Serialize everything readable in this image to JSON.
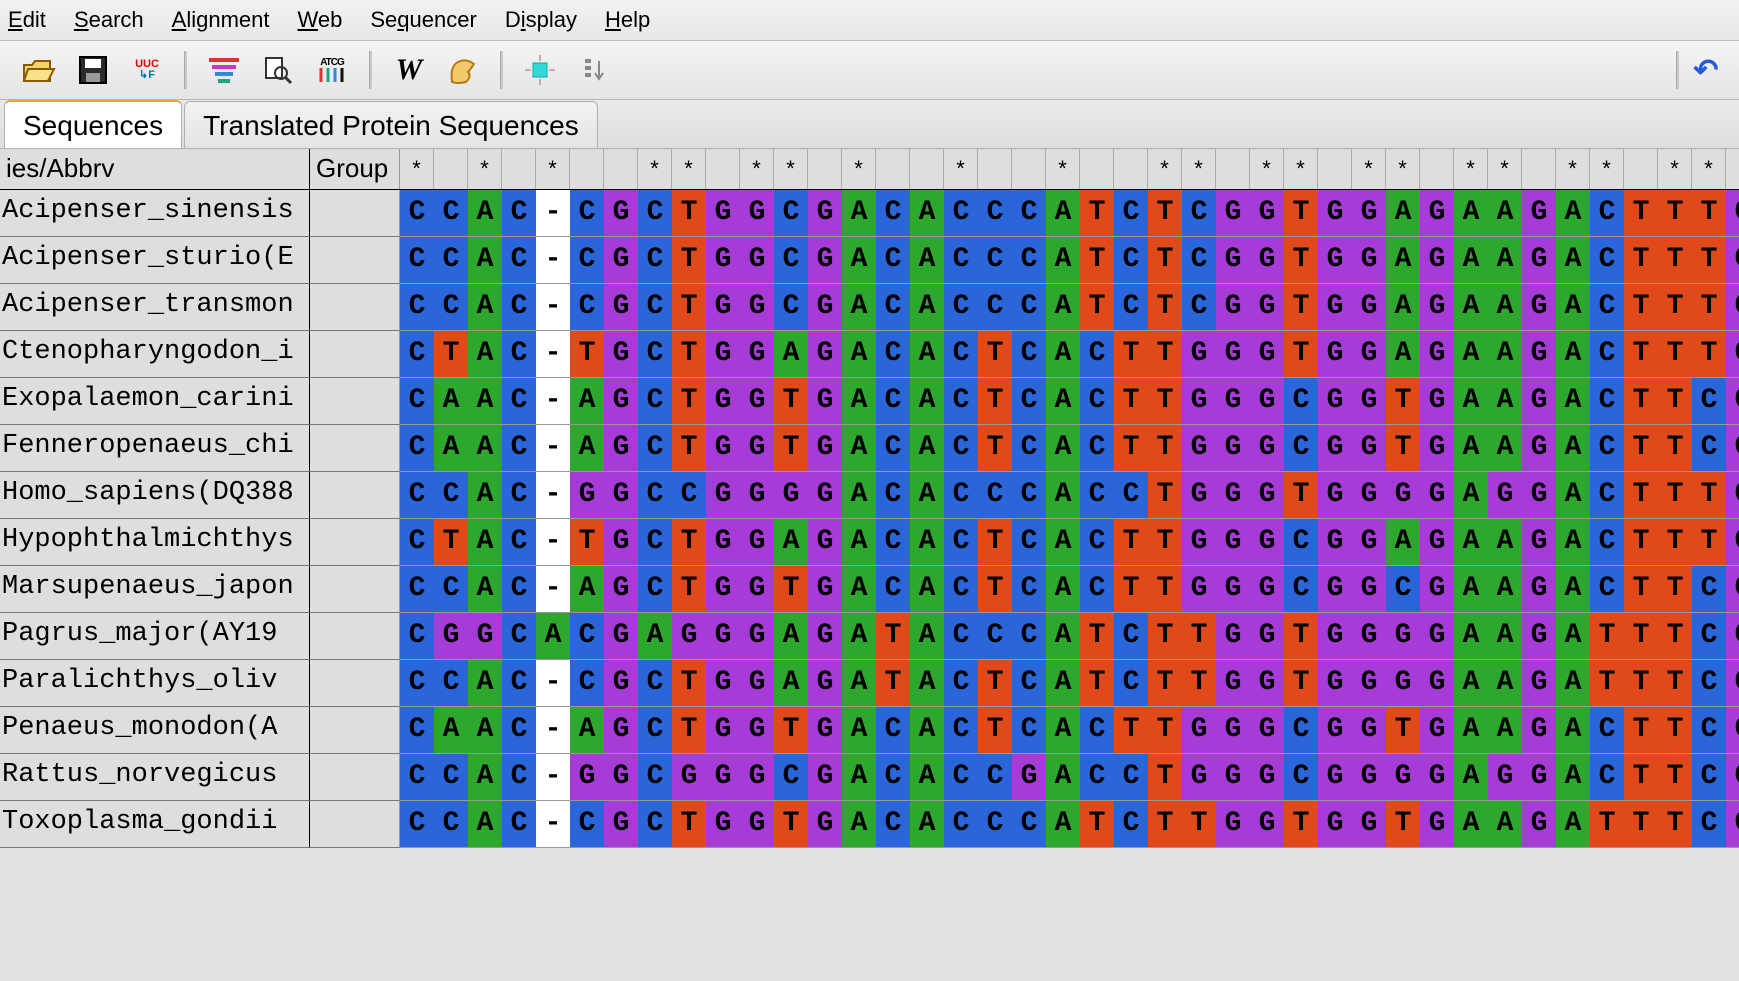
{
  "menu": {
    "items": [
      {
        "label": "Edit",
        "underline": 0
      },
      {
        "label": "Search",
        "underline": 0
      },
      {
        "label": "Alignment",
        "underline": 0
      },
      {
        "label": "Web",
        "underline": 0
      },
      {
        "label": "Sequencer",
        "underline": 2
      },
      {
        "label": "Display",
        "underline": 1
      },
      {
        "label": "Help",
        "underline": 0
      }
    ]
  },
  "tabs": {
    "items": [
      {
        "label": "Sequences",
        "active": true
      },
      {
        "label": "Translated Protein Sequences",
        "active": false
      }
    ]
  },
  "toolbar_icons": [
    "open-file-icon",
    "save-icon",
    "codon-icon",
    "sep",
    "align-colors-icon",
    "find-icon",
    "atcg-icon",
    "sep",
    "w-bold-icon",
    "muscle-icon",
    "sep",
    "highlight-icon",
    "sort-icon"
  ],
  "undo_icon": "↶",
  "uuc_label_top": "UUC",
  "uuc_label_bot": "↳F",
  "columns": {
    "name_header": "ies/Abbrv",
    "group_header": "Group"
  },
  "ruler_marks": "* * *  ** ** *  *  *  ** ** ** ** ** ** *****",
  "sequences": [
    {
      "name": "Acipenser_sinensis",
      "group": "",
      "seq": "CCAC-CGCTGGCGACACCCATCTCGGTGGAGAAGACTTTGACAAC"
    },
    {
      "name": "Acipenser_sturio(E",
      "group": "",
      "seq": "CCAC-CGCTGGCGACACCCATCTCGGTGGAGAAGACTTTGACAAC"
    },
    {
      "name": "Acipenser_transmon",
      "group": "",
      "seq": "CCAC-CGCTGGCGACACCCATCTCGGTGGAGAAGACTTTGACAAC"
    },
    {
      "name": "Ctenopharyngodon_i",
      "group": "",
      "seq": "CTAC-TGCTGGAGACACTCACTTGGGTGGAGAAGACTTTGACAAC"
    },
    {
      "name": "Exopalaemon_carini",
      "group": "",
      "seq": "CAAC-AGCTGGTGACACTCACTTGGGCGGTGAAGACTTCGACAAC"
    },
    {
      "name": "Fenneropenaeus_chi",
      "group": "",
      "seq": "CAAC-AGCTGGTGACACTCACTTGGGCGGTGAAGACTTCGACAAC"
    },
    {
      "name": "Homo_sapiens(DQ388",
      "group": "",
      "seq": "CCAC-GGCCGGGGACACCCACCTGGGTGGGGAGGACTTTGACAAC"
    },
    {
      "name": "Hypophthalmichthys",
      "group": "",
      "seq": "CTAC-TGCTGGAGACACTCACTTGGGCGGAGAAGACTTTGACAAC"
    },
    {
      "name": "Marsupenaeus_japon",
      "group": "",
      "seq": "CCAC-AGCTGGTGACACTCACTTGGGCGGCGAAGACTTCGACAAC"
    },
    {
      "name": "Pagrus_major(AY19",
      "group": "",
      "seq": "CGGCACGAGGGAGATACCCATCTTGGTGGGGAAGATTTCGACAAC"
    },
    {
      "name": "Paralichthys_oliv",
      "group": "",
      "seq": "CCAC-CGCTGGAGATACTCATCTTGGTGGGGAAGATTTCGACAAC"
    },
    {
      "name": "Penaeus_monodon(A",
      "group": "",
      "seq": "CAAC-AGCTGGTGACACTCACTTGGGCGGTGAAGACTTCGACAAC"
    },
    {
      "name": "Rattus_norvegicus",
      "group": "",
      "seq": "CCAC-GGCGGGCGACACCGACCTGGGCGGGGAGGACTTCGACAAC"
    },
    {
      "name": "Toxoplasma_gondii",
      "group": "",
      "seq": "CCAC-CGCTGGTGACACCCATCTTGGTGGTGAAGATTTCGACAAC"
    }
  ]
}
